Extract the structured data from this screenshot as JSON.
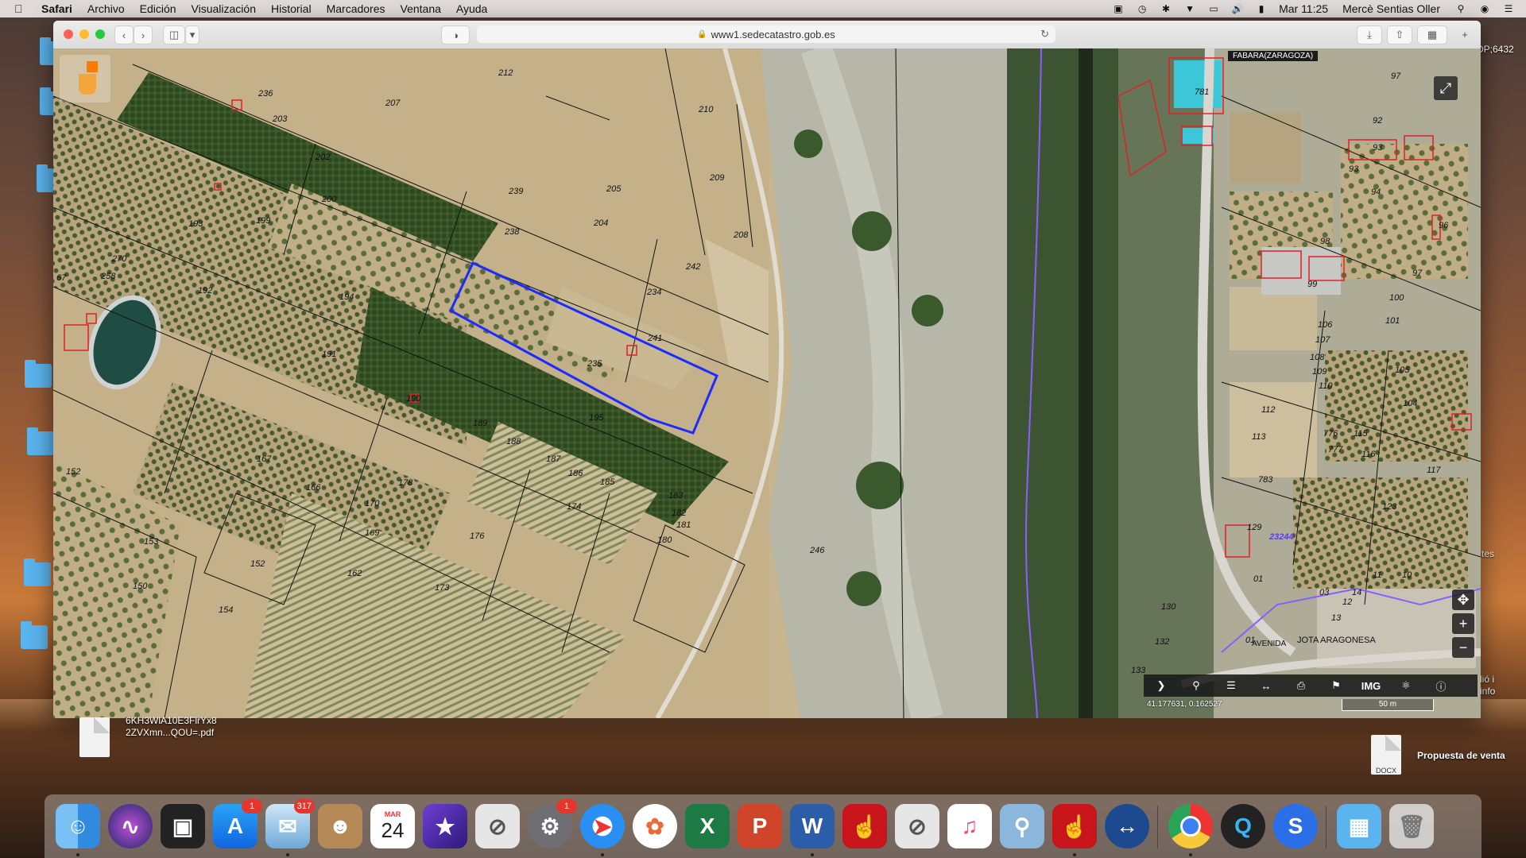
{
  "menubar": {
    "app": "Safari",
    "menus": [
      "Archivo",
      "Edición",
      "Visualización",
      "Historial",
      "Marcadores",
      "Ventana",
      "Ayuda"
    ],
    "clock": "Mar 11:25",
    "user": "Mercè Sentias Oller"
  },
  "browser": {
    "url": "www1.sedecatastro.gob.es"
  },
  "map": {
    "region_label": "FABARA(ZARAGOZA)",
    "coordinates": "41.177631, 0.162527",
    "scale": "50 m",
    "street_label": "JOTA ARAGONESA",
    "street_label_2": "AVENIDA",
    "parcel_numbers": [
      "212",
      "236",
      "207",
      "203",
      "210",
      "202",
      "209",
      "205",
      "239",
      "204",
      "200",
      "199",
      "193",
      "238",
      "208",
      "242",
      "67",
      "270",
      "258",
      "192",
      "234",
      "194",
      "241",
      "191",
      "235",
      "190",
      "189",
      "188",
      "195",
      "167",
      "186",
      "178",
      "187",
      "185",
      "183",
      "152",
      "166",
      "182",
      "153",
      "181",
      "170",
      "176",
      "169",
      "174",
      "180",
      "150",
      "152",
      "162",
      "173",
      "246",
      "154",
      "781",
      "97",
      "92",
      "93",
      "94",
      "96",
      "98",
      "99",
      "97",
      "100",
      "101",
      "106",
      "105",
      "107",
      "108",
      "109",
      "110",
      "112",
      "104",
      "113",
      "116",
      "115",
      "117",
      "776",
      "777",
      "783",
      "123",
      "129",
      "23244",
      "01",
      "03",
      "14",
      "10",
      "11",
      "12",
      "13",
      "130",
      "132",
      "133",
      "01",
      "93"
    ],
    "toolbar_buttons": [
      ">",
      "search",
      "layers",
      "measure",
      "print",
      "ref",
      "IMG",
      "bike",
      "info"
    ],
    "toolbar_img_label": "IMG"
  },
  "desktop": {
    "files": [
      {
        "name_line1": "6KH3WlA10E3FlrYx8",
        "name_line2": "2ZVXmn...QOU=.pdf"
      },
      {
        "name": "Propuesta de venta",
        "ext": "DOCX"
      }
    ],
    "side_text_1": "DP;6432",
    "side_text_2": "tes",
    "side_text_3": "lió i",
    "side_text_4": "info"
  },
  "dock": {
    "calendar_month": "MAR",
    "calendar_day": "24",
    "badges": {
      "appstore": "1",
      "mail": "317",
      "sysprefs": "1"
    }
  },
  "colors": {
    "highlight_parcel": "#1c2bff",
    "urban_parcel": "#e0202a",
    "boundary": "#8b5cff"
  }
}
